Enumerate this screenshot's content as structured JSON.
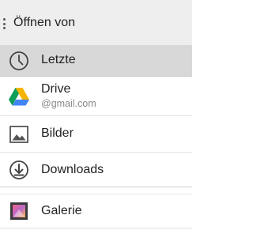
{
  "header": {
    "title": "Öffnen von"
  },
  "items": [
    {
      "label": "Letzte",
      "icon": "clock-icon",
      "selected": true
    },
    {
      "label": "Drive",
      "sublabel": "@gmail.com",
      "icon": "google-drive-icon"
    },
    {
      "label": "Bilder",
      "icon": "image-icon"
    },
    {
      "label": "Downloads",
      "icon": "download-icon"
    },
    {
      "label": "Galerie",
      "icon": "gallery-icon"
    }
  ],
  "colors": {
    "header_bg": "#eeeeee",
    "selected_bg": "#d8d8d8",
    "text": "#222222",
    "subtext": "#8a8a8a"
  }
}
